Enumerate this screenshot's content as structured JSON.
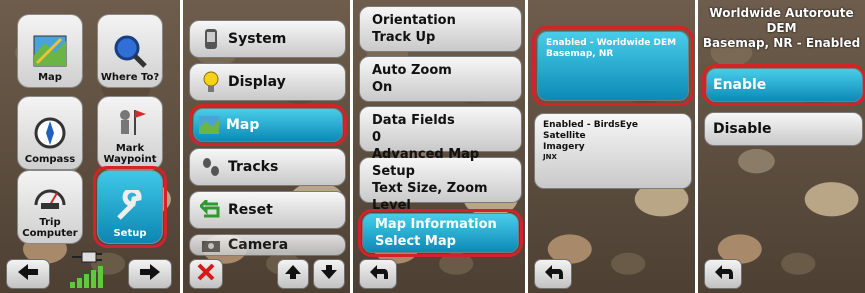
{
  "panel1": {
    "tiles": [
      {
        "label": "Map",
        "icon": "map-icon"
      },
      {
        "label": "Where To?",
        "icon": "magnifier-icon"
      },
      {
        "label": "Compass",
        "icon": "compass-icon"
      },
      {
        "label": "Mark Waypoint",
        "icon": "flag-icon"
      },
      {
        "label": "Trip Computer",
        "icon": "speedometer-icon"
      },
      {
        "label": "Setup",
        "icon": "wrench-icon"
      }
    ],
    "status_icons": [
      "back-arrow-icon",
      "power-plug-icon",
      "signal-bars-icon",
      "forward-arrow-icon"
    ]
  },
  "panel2": {
    "items": [
      {
        "label": "System",
        "icon": "phone-icon"
      },
      {
        "label": "Display",
        "icon": "bulb-icon"
      },
      {
        "label": "Map",
        "icon": "map-icon"
      },
      {
        "label": "Tracks",
        "icon": "footprints-icon"
      },
      {
        "label": "Reset",
        "icon": "reset-arrow-icon"
      },
      {
        "label": "Camera",
        "icon": "camera-icon"
      }
    ],
    "nav_icons": [
      "close-icon",
      "up-arrow-icon",
      "down-arrow-icon"
    ]
  },
  "panel3": {
    "items": [
      {
        "line1": "Orientation",
        "line2": "Track Up"
      },
      {
        "line1": "Auto Zoom",
        "line2": "On"
      },
      {
        "line1": "Data Fields",
        "line2": "0"
      },
      {
        "line1": "Advanced Map Setup",
        "line2": "Text Size, Zoom Level"
      },
      {
        "line1": "Map Information",
        "line2": "Select Map"
      }
    ],
    "nav_icons": [
      "back-icon"
    ]
  },
  "panel4": {
    "items": [
      {
        "line1": "Enabled - Worldwide DEM",
        "line2": "Basemap, NR",
        "line3": ""
      },
      {
        "line1": "Enabled - BirdsEye Satellite",
        "line2": "Imagery",
        "line3": "JNX"
      }
    ],
    "nav_icons": [
      "back-icon"
    ]
  },
  "panel5": {
    "title_line1": "Worldwide Autoroute DEM",
    "title_line2": "Basemap, NR - Enabled",
    "buttons": [
      "Enable",
      "Disable"
    ],
    "nav_icons": [
      "back-icon"
    ]
  },
  "colors": {
    "highlight": "#d4222a",
    "active": "#1aa3cf"
  }
}
